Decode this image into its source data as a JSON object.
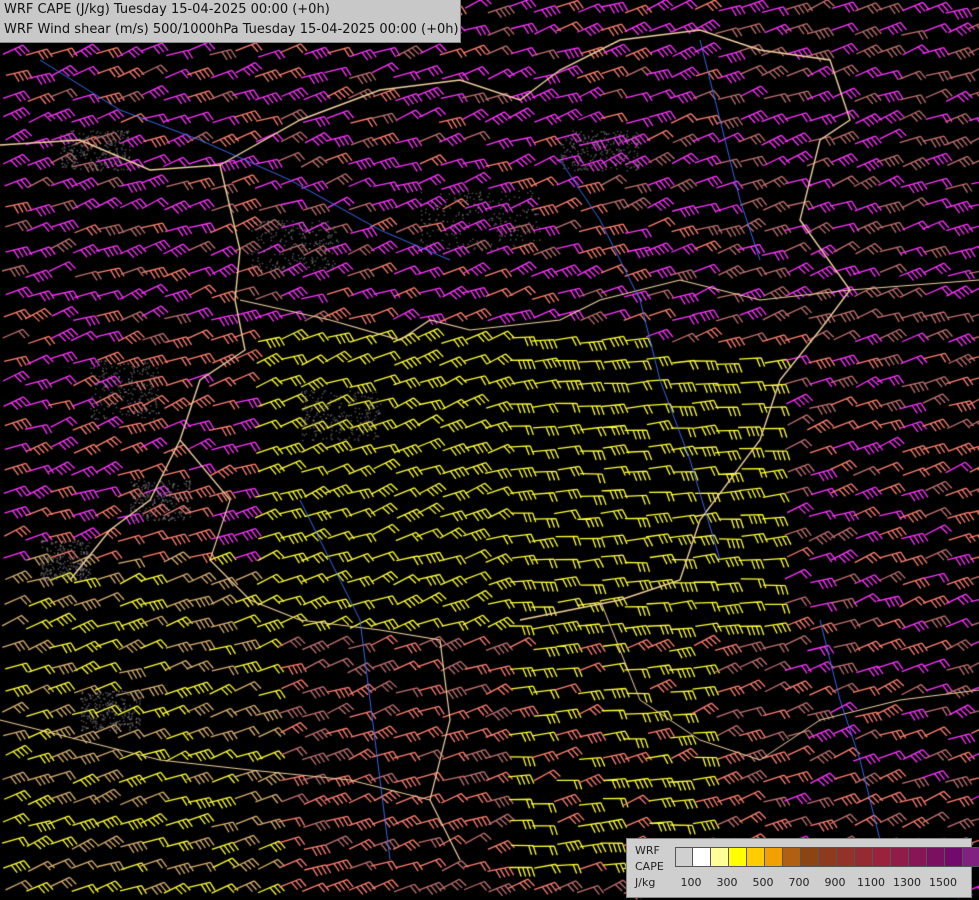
{
  "titles": {
    "line1": "WRF CAPE (J/kg) Tuesday 15-04-2025 00:00 (+0h)",
    "line2": "WRF Wind shear (m/s) 500/1000hPa Tuesday 15-04-2025 00:00 (+0h)"
  },
  "legend": {
    "model": "WRF",
    "field": "CAPE",
    "unit": "J/kg",
    "colors": [
      "#d0d0d0",
      "#ffffff",
      "#ffff99",
      "#ffff00",
      "#ffcc00",
      "#f0a000",
      "#b06010",
      "#8a4513",
      "#8e3a1e",
      "#923228",
      "#962a32",
      "#9a223c",
      "#901c48",
      "#861654",
      "#7c1060",
      "#720a6c",
      "#802080"
    ],
    "ticks": [
      "100",
      "300",
      "500",
      "700",
      "900",
      "1100",
      "1300",
      "1500"
    ]
  },
  "barb_colors": {
    "magenta": "#ff33ff",
    "yellow": "#ffff33",
    "salmon": "#ff8070",
    "brown": "#c07070",
    "tan": "#d8b070",
    "border": "#f0d0a0",
    "river": "#4070ff"
  }
}
